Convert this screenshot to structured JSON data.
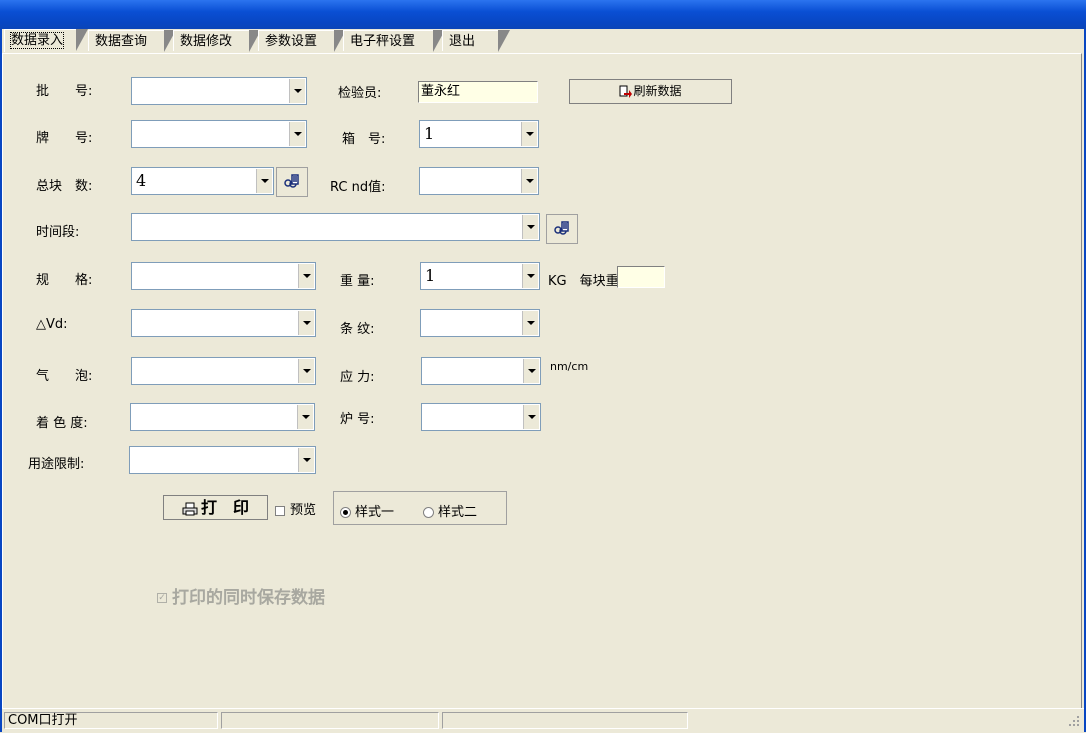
{
  "tabs": [
    "数据录入",
    "数据查询",
    "数据修改",
    "参数设置",
    "电子秤设置",
    "退出"
  ],
  "form": {
    "batch_label": "批　　号:",
    "brand_label": "牌　　号:",
    "total_label": "总块　数:",
    "total_value": "4",
    "timespan_label": "时间段:",
    "spec_label": "规　　格:",
    "dvd_label": "△Vd:",
    "bubble_label": "气　　泡:",
    "color_label": "着 色 度:",
    "usage_label": "用途限制:",
    "inspector_label": "检验员:",
    "inspector_value": "董永红",
    "box_label": "箱　号:",
    "box_value": "1",
    "rc_label": "RC nd值:",
    "weight_label": "重 量:",
    "weight_value": "1",
    "kg_label": "KG",
    "per_block_label": "每块重",
    "stripe_label": "条 纹:",
    "stress_label": "应 力:",
    "stress_unit": "nm/cm",
    "furnace_label": "炉 号:",
    "refresh_label": "刷新数据",
    "print_label": "打　印",
    "preview_label": "预览",
    "style1_label": "样式一",
    "style2_label": "样式二",
    "save_label": "打印的同时保存数据"
  },
  "status": {
    "text": "COM口打开"
  }
}
